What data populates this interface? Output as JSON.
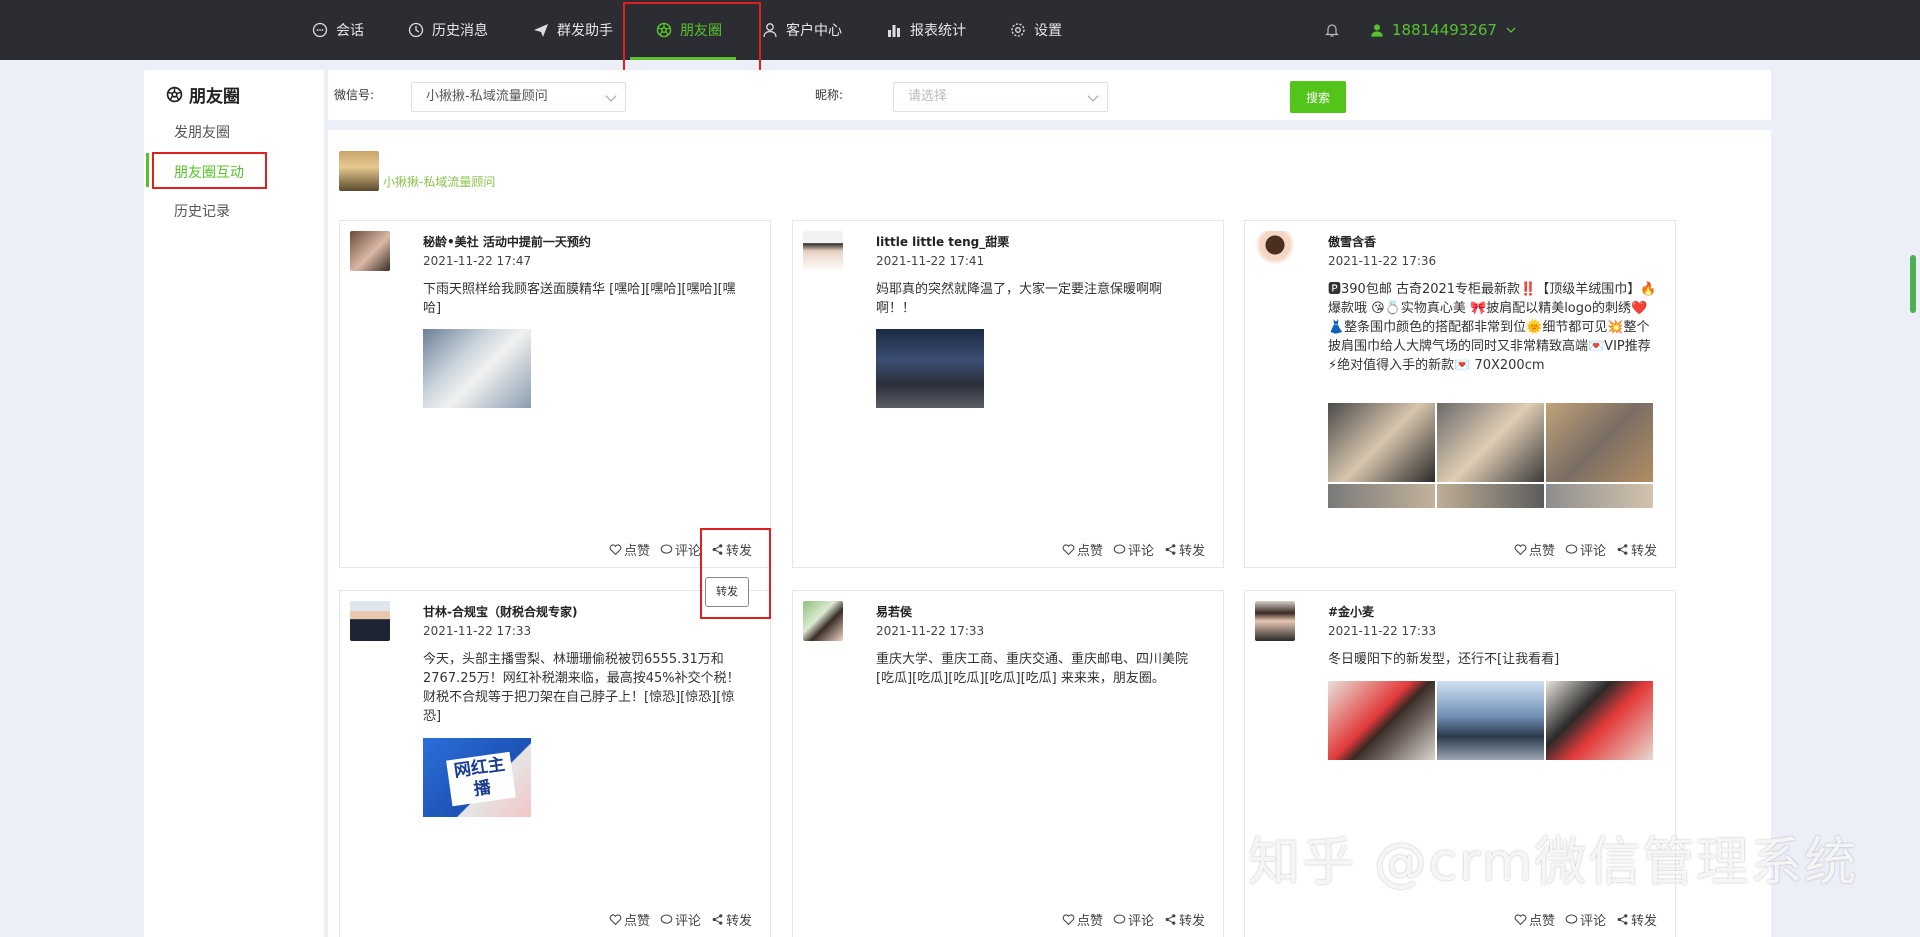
{
  "nav": {
    "items": [
      {
        "label": "会话",
        "icon": "chat-icon"
      },
      {
        "label": "历史消息",
        "icon": "clock-icon"
      },
      {
        "label": "群发助手",
        "icon": "send-icon"
      },
      {
        "label": "朋友圈",
        "icon": "moments-icon"
      },
      {
        "label": "客户中心",
        "icon": "person-icon"
      },
      {
        "label": "报表统计",
        "icon": "bar-chart-icon"
      },
      {
        "label": "设置",
        "icon": "gear-icon"
      }
    ],
    "active_index": 3,
    "user_phone": "18814493267",
    "accent": "#57c22d"
  },
  "sidebar": {
    "title": "朋友圈",
    "items": [
      {
        "label": "发朋友圈"
      },
      {
        "label": "朋友圈互动"
      },
      {
        "label": "历史记录"
      }
    ],
    "active_index": 1
  },
  "filters": {
    "wechat_label": "微信号:",
    "wechat_value": "小揪揪-私域流量顾问",
    "nickname_label": "昵称:",
    "nickname_placeholder": "请选择",
    "search_label": "搜索"
  },
  "account": {
    "name": "小揪揪-私域流量顾问"
  },
  "posts": [
    {
      "nick": "秘龄•美社 活动中提前一天预约",
      "time": "2021-11-22 17:47",
      "text": "下雨天照样给我顾客送面膜精华 [嘿哈][嘿哈][嘿哈][嘿哈]"
    },
    {
      "nick": "little little teng_甜栗",
      "time": "2021-11-22 17:41",
      "text": "妈耶真的突然就降温了，大家一定要注意保暖啊啊啊！！"
    },
    {
      "nick": "傲雪含香",
      "time": "2021-11-22 17:36",
      "text": "🅿390包邮 古奇2021专柜最新款‼️【顶级羊绒围巾】🔥爆款哦 😘💍实物真心美 🎀披肩配以精美logo的刺绣❤️👗整条围巾颜色的搭配都非常到位🌞细节都可见💥整个披肩围巾给人大牌气场的同时又非常精致高端💌VIP推荐⚡绝对值得入手的新款💌 70X200cm"
    },
    {
      "nick": "甘林-合规宝（财税合规专家)",
      "time": "2021-11-22 17:33",
      "text": "今天，头部主播雪梨、林珊珊偷税被罚6555.31万和2767.25万！网红补税潮来临，最高按45%补交个税！财税不合规等于把刀架在自己脖子上！[惊恐][惊恐][惊恐]",
      "image_text": "网红主播"
    },
    {
      "nick": "易若侯",
      "time": "2021-11-22 17:33",
      "text": "重庆大学、重庆工商、重庆交通、重庆邮电、四川美院 [吃瓜][吃瓜][吃瓜][吃瓜][吃瓜] 来来来，朋友圈。"
    },
    {
      "nick": "#金小麦",
      "time": "2021-11-22 17:33",
      "text": "冬日暖阳下的新发型，还行不[让我看看]"
    }
  ],
  "actions": {
    "like": "点赞",
    "comment": "评论",
    "forward": "转发"
  },
  "tooltip": "转发",
  "watermark": "知乎 @crm微信管理系统"
}
